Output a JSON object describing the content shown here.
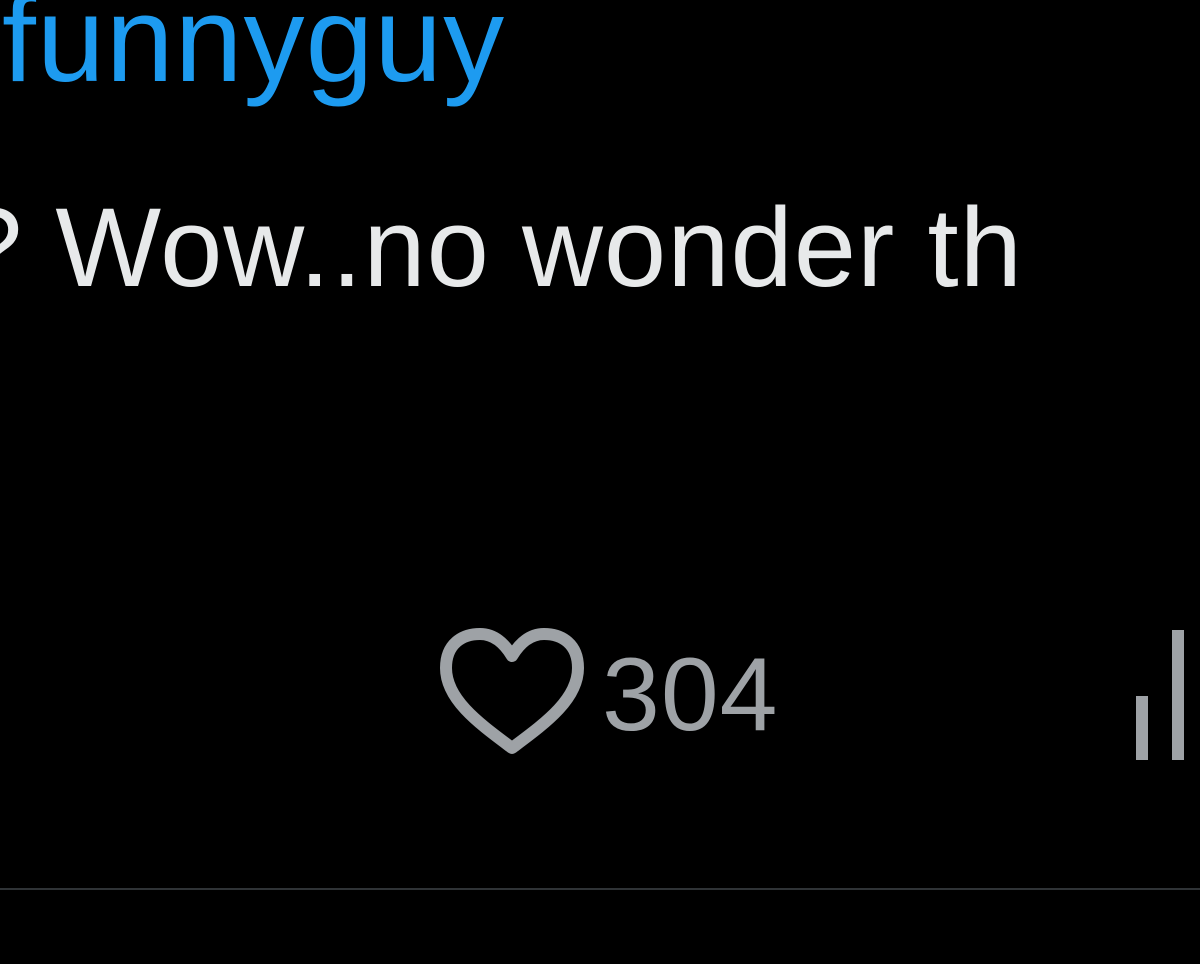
{
  "post": {
    "mention": "funnyguy",
    "text": "? Wow..no wonder th"
  },
  "actions": {
    "like": {
      "icon": "heart-icon",
      "count": "304"
    },
    "views": {
      "icon": "bar-chart-icon"
    }
  },
  "colors": {
    "background": "#000000",
    "mention": "#1d9bf0",
    "text": "#e7e9ea",
    "action_gray": "#9ea2a6",
    "divider": "#2f3336"
  }
}
